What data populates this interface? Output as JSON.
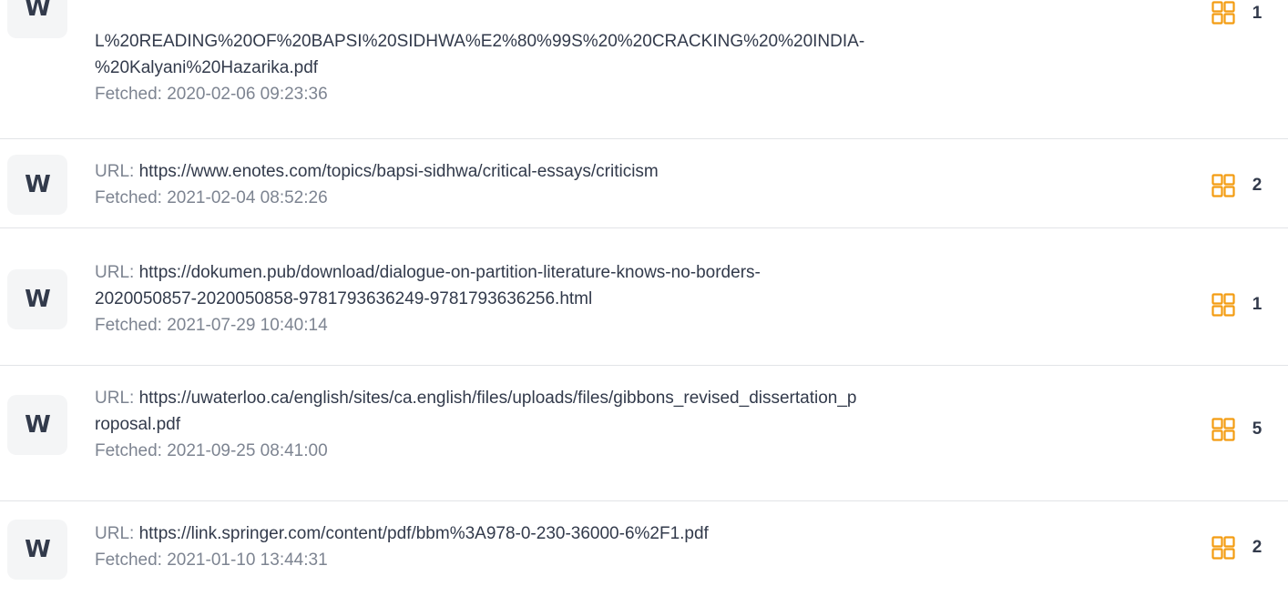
{
  "labels": {
    "url": "URL:",
    "fetched": "Fetched:"
  },
  "sources": [
    {
      "icon": "W",
      "url_lines": [
        "L%20READING%20OF%20BAPSI%20SIDHWA%E2%80%99S%20%20CRACKING%20%20INDIA-",
        "%20Kalyani%20Hazarika.pdf"
      ],
      "fetched": "2020-02-06 09:23:36",
      "count": "1"
    },
    {
      "icon": "W",
      "url_lines": [
        "https://www.enotes.com/topics/bapsi-sidhwa/critical-essays/criticism"
      ],
      "fetched": "2021-02-04 08:52:26",
      "count": "2"
    },
    {
      "icon": "W",
      "url_lines": [
        "https://dokumen.pub/download/dialogue-on-partition-literature-knows-no-borders-",
        "2020050857-2020050858-9781793636249-9781793636256.html"
      ],
      "fetched": "2021-07-29 10:40:14",
      "count": "1"
    },
    {
      "icon": "W",
      "url_lines": [
        "https://uwaterloo.ca/english/sites/ca.english/files/uploads/files/gibbons_revised_dissertation_p",
        "roposal.pdf"
      ],
      "fetched": "2021-09-25 08:41:00",
      "count": "5"
    },
    {
      "icon": "W",
      "url_lines": [
        "https://link.springer.com/content/pdf/bbm%3A978-0-230-36000-6%2F1.pdf"
      ],
      "fetched": "2021-01-10 13:44:31",
      "count": "2"
    }
  ],
  "colors": {
    "accent": "#f39c12",
    "text": "#323a4b",
    "muted": "#7d8491",
    "icon_bg": "#f4f5f6",
    "divider": "#e2e4e7"
  },
  "icons": {
    "source": "wikipedia-w-icon",
    "matches": "grid-squares-icon"
  }
}
